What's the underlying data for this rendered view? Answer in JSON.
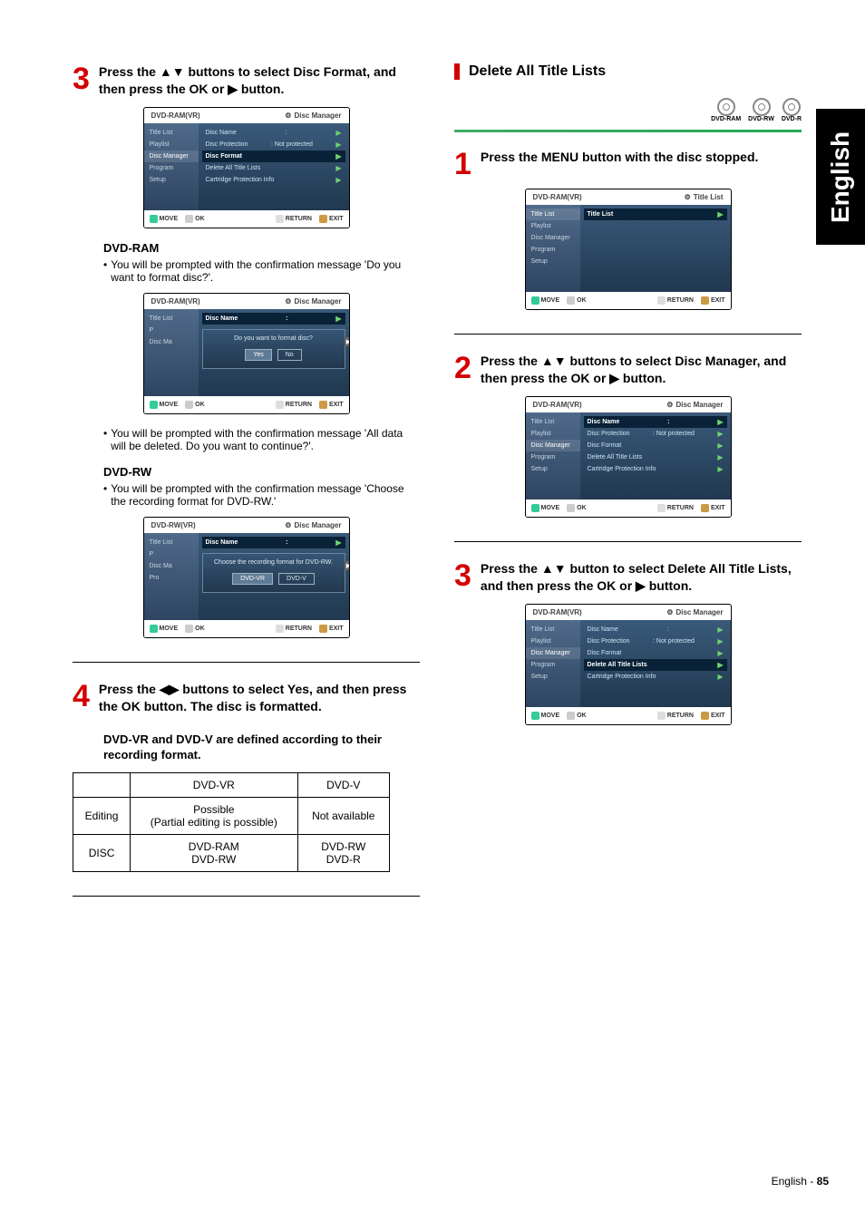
{
  "side_tab": "English",
  "footer": {
    "lang": "English - ",
    "page": "85"
  },
  "left": {
    "step3": {
      "num": "3",
      "text": "Press the ▲▼ buttons to select Disc Format, and then press the OK or ▶ button."
    },
    "osd1": {
      "mode": "DVD-RAM(VR)",
      "hdr": "Disc Manager",
      "left_items": [
        "Title List",
        "Playlist",
        "Disc Manager",
        "Program",
        "Setup"
      ],
      "rows": [
        {
          "l": "Disc Name",
          "r": ":"
        },
        {
          "l": "Disc Protection",
          "r": ": Not protected"
        },
        {
          "l": "Disc Format",
          "r": ""
        },
        {
          "l": "Delete All Title Lists",
          "r": ""
        },
        {
          "l": "Cartridge Protection Info",
          "r": ""
        }
      ],
      "selIndex": 2,
      "footer": [
        "MOVE",
        "OK",
        "RETURN",
        "EXIT"
      ]
    },
    "sub_ram": "DVD-RAM",
    "bullet_ram": "You will be prompted with the confirmation message 'Do you want to format disc?'.",
    "osd2": {
      "mode": "DVD-RAM(VR)",
      "hdr": "Disc Manager",
      "left_items": [
        "Title List",
        "P",
        "Disc Ma",
        "",
        ""
      ],
      "row0": {
        "l": "Disc Name",
        "r": ":"
      },
      "dialog_text": "Do you want to format disc?",
      "yes": "Yes",
      "no": "No",
      "footer": [
        "MOVE",
        "OK",
        "RETURN",
        "EXIT"
      ]
    },
    "bullet_alldata": "You will be prompted with the confirmation message 'All data will be deleted. Do you want to continue?'.",
    "sub_rw": "DVD-RW",
    "bullet_rw": "You will be prompted with the confirmation message 'Choose the recording format for DVD-RW.'",
    "osd3": {
      "mode": "DVD-RW(VR)",
      "hdr": "Disc Manager",
      "left_items": [
        "Title List",
        "P",
        "Disc Ma",
        "Pro",
        ""
      ],
      "row0": {
        "l": "Disc Name",
        "r": ":"
      },
      "dialog_text": "Choose the recording format for DVD-RW.",
      "btn1": "DVD-VR",
      "btn2": "DVD-V",
      "footer": [
        "MOVE",
        "OK",
        "RETURN",
        "EXIT"
      ]
    },
    "step4": {
      "num": "4",
      "text": "Press the ◀▶ buttons to select Yes, and then press the OK button. The disc is formatted."
    },
    "def_line": "DVD-VR and DVD-V are defined according to their recording format.",
    "table": {
      "h1": "",
      "h2": "DVD-VR",
      "h3": "DVD-V",
      "r1c1": "Editing",
      "r1c2": "Possible\n(Partial editing is possible)",
      "r1c3": "Not available",
      "r2c1": "DISC",
      "r2c2": "DVD-RAM\nDVD-RW",
      "r2c3": "DVD-RW\nDVD-R"
    }
  },
  "right": {
    "title": "Delete All Title Lists",
    "badges": [
      "DVD-RAM",
      "DVD-RW",
      "DVD-R"
    ],
    "step1": {
      "num": "1",
      "text": "Press the MENU button with the disc stopped."
    },
    "osd1": {
      "mode": "DVD-RAM(VR)",
      "hdr": "Title List",
      "left_items": [
        "Title List",
        "Playlist",
        "Disc Manager",
        "Program",
        "Setup"
      ],
      "rows": [
        {
          "l": "Title List",
          "r": ""
        }
      ],
      "selIndex": 0,
      "footer": [
        "MOVE",
        "OK",
        "RETURN",
        "EXIT"
      ]
    },
    "step2": {
      "num": "2",
      "text": "Press the ▲▼ buttons to select Disc Manager, and then press the OK or ▶ button."
    },
    "osd2": {
      "mode": "DVD-RAM(VR)",
      "hdr": "Disc Manager",
      "left_items": [
        "Title List",
        "Playlist",
        "Disc Manager",
        "Program",
        "Setup"
      ],
      "rows": [
        {
          "l": "Disc Name",
          "r": ":"
        },
        {
          "l": "Disc Protection",
          "r": ": Not protected"
        },
        {
          "l": "Disc Format",
          "r": ""
        },
        {
          "l": "Delete All Title Lists",
          "r": ""
        },
        {
          "l": "Cartridge Protection Info",
          "r": ""
        }
      ],
      "selIndex": 0,
      "footer": [
        "MOVE",
        "OK",
        "RETURN",
        "EXIT"
      ]
    },
    "step3": {
      "num": "3",
      "text": "Press the ▲▼ button to select Delete All Title Lists, and then press the OK or ▶ button."
    },
    "osd3": {
      "mode": "DVD-RAM(VR)",
      "hdr": "Disc Manager",
      "left_items": [
        "Title List",
        "Playlist",
        "Disc Manager",
        "Program",
        "Setup"
      ],
      "rows": [
        {
          "l": "Disc Name",
          "r": ":"
        },
        {
          "l": "Disc Protection",
          "r": ": Not protected"
        },
        {
          "l": "Disc Format",
          "r": ""
        },
        {
          "l": "Delete All Title Lists",
          "r": ""
        },
        {
          "l": "Cartridge Protection Info",
          "r": ""
        }
      ],
      "selIndex": 3,
      "footer": [
        "MOVE",
        "OK",
        "RETURN",
        "EXIT"
      ]
    }
  }
}
